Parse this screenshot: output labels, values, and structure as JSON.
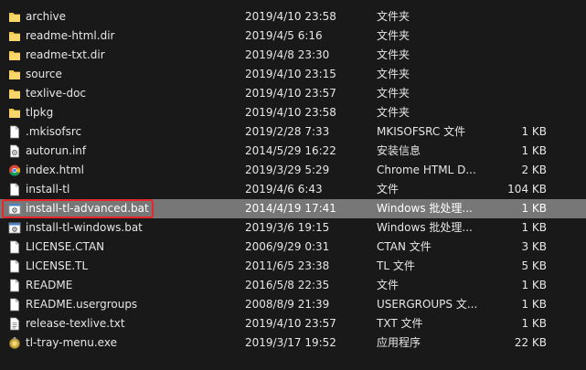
{
  "files": [
    {
      "name": "archive",
      "date": "2019/4/10 23:58",
      "type": "文件夹",
      "size": "",
      "icon": "folder-icon"
    },
    {
      "name": "readme-html.dir",
      "date": "2019/4/5 6:16",
      "type": "文件夹",
      "size": "",
      "icon": "folder-icon"
    },
    {
      "name": "readme-txt.dir",
      "date": "2019/4/8 23:30",
      "type": "文件夹",
      "size": "",
      "icon": "folder-icon"
    },
    {
      "name": "source",
      "date": "2019/4/10 23:15",
      "type": "文件夹",
      "size": "",
      "icon": "folder-icon"
    },
    {
      "name": "texlive-doc",
      "date": "2019/4/10 23:57",
      "type": "文件夹",
      "size": "",
      "icon": "folder-icon"
    },
    {
      "name": "tlpkg",
      "date": "2019/4/10 23:58",
      "type": "文件夹",
      "size": "",
      "icon": "folder-icon"
    },
    {
      "name": ".mkisofsrc",
      "date": "2019/2/28 7:33",
      "type": "MKISOFSRC 文件",
      "size": "1 KB",
      "icon": "file-icon"
    },
    {
      "name": "autorun.inf",
      "date": "2014/5/29 16:22",
      "type": "安装信息",
      "size": "1 KB",
      "icon": "setup-info-icon"
    },
    {
      "name": "index.html",
      "date": "2019/3/29 5:29",
      "type": "Chrome HTML D...",
      "size": "2 KB",
      "icon": "chrome-icon"
    },
    {
      "name": "install-tl",
      "date": "2019/4/6 6:43",
      "type": "文件",
      "size": "104 KB",
      "icon": "file-icon"
    },
    {
      "name": "install-tl-advanced.bat",
      "date": "2014/4/19 17:41",
      "type": "Windows 批处理...",
      "size": "1 KB",
      "icon": "batch-file-icon",
      "selected": true
    },
    {
      "name": "install-tl-windows.bat",
      "date": "2019/3/6 19:15",
      "type": "Windows 批处理...",
      "size": "1 KB",
      "icon": "batch-file-icon"
    },
    {
      "name": "LICENSE.CTAN",
      "date": "2006/9/29 0:31",
      "type": "CTAN 文件",
      "size": "3 KB",
      "icon": "file-icon"
    },
    {
      "name": "LICENSE.TL",
      "date": "2011/6/5 23:38",
      "type": "TL 文件",
      "size": "5 KB",
      "icon": "file-icon"
    },
    {
      "name": "README",
      "date": "2016/5/8 22:35",
      "type": "文件",
      "size": "1 KB",
      "icon": "file-icon"
    },
    {
      "name": "README.usergroups",
      "date": "2008/8/9 21:39",
      "type": "USERGROUPS 文...",
      "size": "1 KB",
      "icon": "file-icon"
    },
    {
      "name": "release-texlive.txt",
      "date": "2019/4/10 23:57",
      "type": "TXT 文件",
      "size": "1 KB",
      "icon": "text-file-icon"
    },
    {
      "name": "tl-tray-menu.exe",
      "date": "2019/3/17 19:52",
      "type": "应用程序",
      "size": "22 KB",
      "icon": "application-icon"
    }
  ],
  "colors": {
    "background": "#191919",
    "text": "#e6e6e6",
    "selection": "#777777",
    "highlight_border": "#e8262b",
    "folder": "#f2c744"
  }
}
